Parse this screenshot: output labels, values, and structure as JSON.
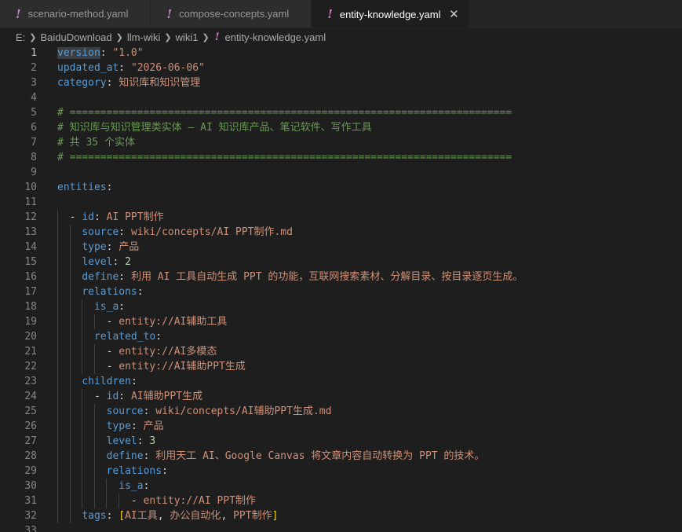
{
  "tabs": [
    {
      "name": "scenario-method.yaml",
      "active": false
    },
    {
      "name": "compose-concepts.yaml",
      "active": false
    },
    {
      "name": "entity-knowledge.yaml",
      "active": true
    }
  ],
  "tab_icon": "!",
  "close_icon": "✕",
  "breadcrumb": [
    "E:",
    "BaiduDownload",
    "llm-wiki",
    "wiki1",
    "entity-knowledge.yaml"
  ],
  "editor": {
    "lines": [
      {
        "n": "1",
        "tokens": [
          [
            "k",
            "version"
          ],
          [
            "p",
            ": "
          ],
          [
            "s",
            "\"1.0\""
          ]
        ]
      },
      {
        "n": "2",
        "tokens": [
          [
            "k",
            "updated_at"
          ],
          [
            "p",
            ": "
          ],
          [
            "s",
            "\"2026-06-06\""
          ]
        ]
      },
      {
        "n": "3",
        "tokens": [
          [
            "k",
            "category"
          ],
          [
            "p",
            ": "
          ],
          [
            "s",
            "知识库和知识管理"
          ]
        ]
      },
      {
        "n": "4",
        "tokens": []
      },
      {
        "n": "5",
        "tokens": [
          [
            "c",
            "# ========================================================================"
          ]
        ]
      },
      {
        "n": "6",
        "tokens": [
          [
            "c",
            "# 知识库与知识管理类实体 — AI 知识库产品、笔记软件、写作工具"
          ]
        ]
      },
      {
        "n": "7",
        "tokens": [
          [
            "c",
            "# 共 35 个实体"
          ]
        ]
      },
      {
        "n": "8",
        "tokens": [
          [
            "c",
            "# ========================================================================"
          ]
        ]
      },
      {
        "n": "9",
        "tokens": []
      },
      {
        "n": "10",
        "tokens": [
          [
            "k",
            "entities"
          ],
          [
            "p",
            ":"
          ]
        ]
      },
      {
        "n": "11",
        "tokens": []
      },
      {
        "n": "12",
        "tokens": [
          [
            "p",
            "  - "
          ],
          [
            "k",
            "id"
          ],
          [
            "p",
            ": "
          ],
          [
            "s",
            "AI PPT制作"
          ]
        ]
      },
      {
        "n": "13",
        "tokens": [
          [
            "p",
            "    "
          ],
          [
            "k",
            "source"
          ],
          [
            "p",
            ": "
          ],
          [
            "s",
            "wiki/concepts/AI PPT制作.md"
          ]
        ]
      },
      {
        "n": "14",
        "tokens": [
          [
            "p",
            "    "
          ],
          [
            "k",
            "type"
          ],
          [
            "p",
            ": "
          ],
          [
            "s",
            "产品"
          ]
        ]
      },
      {
        "n": "15",
        "tokens": [
          [
            "p",
            "    "
          ],
          [
            "k",
            "level"
          ],
          [
            "p",
            ": "
          ],
          [
            "n",
            "2"
          ]
        ]
      },
      {
        "n": "16",
        "tokens": [
          [
            "p",
            "    "
          ],
          [
            "k",
            "define"
          ],
          [
            "p",
            ": "
          ],
          [
            "s",
            "利用 AI 工具自动生成 PPT 的功能，互联网搜索素材、分解目录、按目录逐页生成。"
          ]
        ]
      },
      {
        "n": "17",
        "tokens": [
          [
            "p",
            "    "
          ],
          [
            "k",
            "relations"
          ],
          [
            "p",
            ":"
          ]
        ]
      },
      {
        "n": "18",
        "tokens": [
          [
            "p",
            "      "
          ],
          [
            "k",
            "is_a"
          ],
          [
            "p",
            ":"
          ]
        ]
      },
      {
        "n": "19",
        "tokens": [
          [
            "p",
            "        - "
          ],
          [
            "s",
            "entity://AI辅助工具"
          ]
        ]
      },
      {
        "n": "20",
        "tokens": [
          [
            "p",
            "      "
          ],
          [
            "k",
            "related_to"
          ],
          [
            "p",
            ":"
          ]
        ]
      },
      {
        "n": "21",
        "tokens": [
          [
            "p",
            "        - "
          ],
          [
            "s",
            "entity://AI多模态"
          ]
        ]
      },
      {
        "n": "22",
        "tokens": [
          [
            "p",
            "        - "
          ],
          [
            "s",
            "entity://AI辅助PPT生成"
          ]
        ]
      },
      {
        "n": "23",
        "tokens": [
          [
            "p",
            "    "
          ],
          [
            "k",
            "children"
          ],
          [
            "p",
            ":"
          ]
        ]
      },
      {
        "n": "24",
        "tokens": [
          [
            "p",
            "      - "
          ],
          [
            "k",
            "id"
          ],
          [
            "p",
            ": "
          ],
          [
            "s",
            "AI辅助PPT生成"
          ]
        ]
      },
      {
        "n": "25",
        "tokens": [
          [
            "p",
            "        "
          ],
          [
            "k",
            "source"
          ],
          [
            "p",
            ": "
          ],
          [
            "s",
            "wiki/concepts/AI辅助PPT生成.md"
          ]
        ]
      },
      {
        "n": "26",
        "tokens": [
          [
            "p",
            "        "
          ],
          [
            "k",
            "type"
          ],
          [
            "p",
            ": "
          ],
          [
            "s",
            "产品"
          ]
        ]
      },
      {
        "n": "27",
        "tokens": [
          [
            "p",
            "        "
          ],
          [
            "k",
            "level"
          ],
          [
            "p",
            ": "
          ],
          [
            "n",
            "3"
          ]
        ]
      },
      {
        "n": "28",
        "tokens": [
          [
            "p",
            "        "
          ],
          [
            "k",
            "define"
          ],
          [
            "p",
            ": "
          ],
          [
            "s",
            "利用天工 AI、Google Canvas 将文章内容自动转换为 PPT 的技术。"
          ]
        ]
      },
      {
        "n": "29",
        "tokens": [
          [
            "p",
            "        "
          ],
          [
            "k",
            "relations"
          ],
          [
            "p",
            ":"
          ]
        ]
      },
      {
        "n": "30",
        "tokens": [
          [
            "p",
            "          "
          ],
          [
            "k",
            "is_a"
          ],
          [
            "p",
            ":"
          ]
        ]
      },
      {
        "n": "31",
        "tokens": [
          [
            "p",
            "            - "
          ],
          [
            "s",
            "entity://AI PPT制作"
          ]
        ]
      },
      {
        "n": "32",
        "tokens": [
          [
            "p",
            "    "
          ],
          [
            "k",
            "tags"
          ],
          [
            "p",
            ": "
          ],
          [
            "b",
            "["
          ],
          [
            "s",
            "AI工具"
          ],
          [
            "p",
            ", "
          ],
          [
            "s",
            "办公自动化"
          ],
          [
            "p",
            ", "
          ],
          [
            "s",
            "PPT制作"
          ],
          [
            "b",
            "]"
          ]
        ]
      },
      {
        "n": "33",
        "tokens": []
      }
    ],
    "current_line": "1",
    "highlighted_word": "version"
  },
  "colors": {
    "keyword": "#569cd6",
    "string": "#ce9178",
    "number": "#b5cea8",
    "comment": "#6a9955",
    "yaml_icon": "#c586c0"
  }
}
